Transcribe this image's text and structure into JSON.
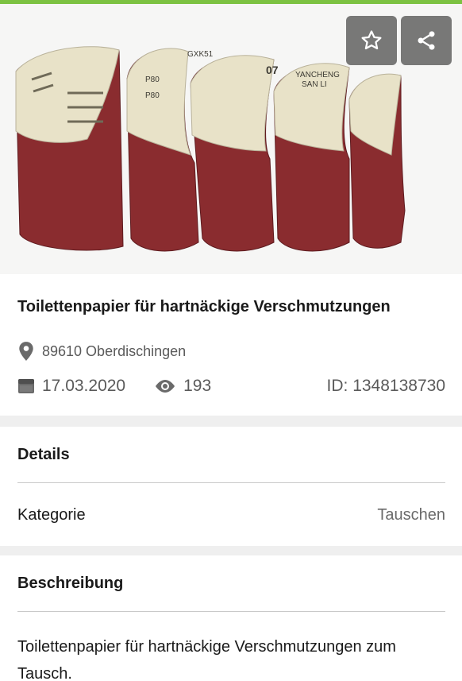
{
  "colors": {
    "accent": "#7cc242",
    "belt": "#8a2c2f",
    "belt_dark": "#5e1b1f",
    "backing": "#e8e2c8",
    "overlay_button": "#464646"
  },
  "photo": {
    "description_icon": "product-photo",
    "backing_prints": [
      "P80",
      "P80",
      "GXK51",
      "YANCHENG",
      "SAN LI",
      "07"
    ]
  },
  "actions": {
    "favorite_icon": "star-outline-icon",
    "share_icon": "share-icon"
  },
  "listing": {
    "title": "Toilettenpapier für hartnäckige Verschmutzungen",
    "location": "89610 Oberdischingen",
    "date": "17.03.2020",
    "views": "193",
    "ad_id": "ID: 1348138730"
  },
  "details": {
    "heading": "Details",
    "rows": [
      {
        "label": "Kategorie",
        "value": "Tauschen"
      }
    ]
  },
  "description": {
    "heading": "Beschreibung",
    "text": "Toilettenpapier für hartnäckige Verschmutzungen zum Tausch."
  }
}
